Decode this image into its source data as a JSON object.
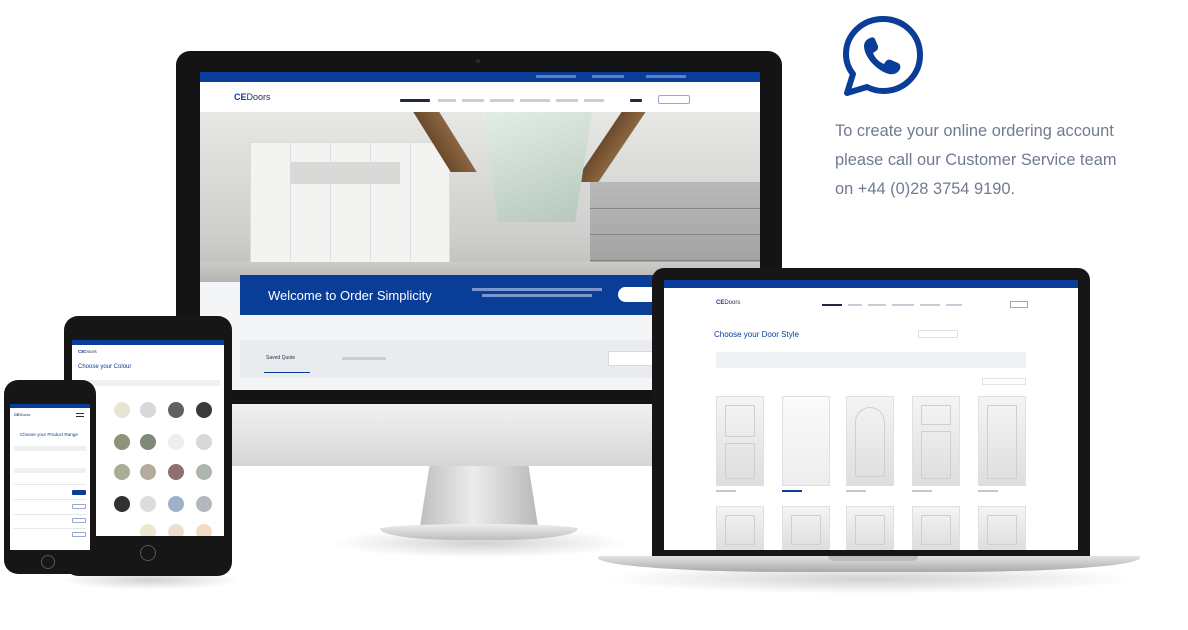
{
  "colors": {
    "brand_blue": "#0a3d97",
    "info_text": "#717b90",
    "device_black": "#161616",
    "whatsapp_blue": "#0a3d97"
  },
  "info": {
    "icon": "whatsapp-icon",
    "lines": [
      "To create your online ordering account",
      "please call our Customer Service team",
      "on +44 (0)28 3754 9190."
    ]
  },
  "desktop": {
    "logo_prefix": "CE",
    "logo_text": "Doors",
    "hero_title": "Welcome to Order Simplicity",
    "tab_active": "Saved Quote"
  },
  "laptop": {
    "logo_prefix": "CE",
    "logo_text": "Doors",
    "page_title": "Choose your Door Style"
  },
  "tablet": {
    "logo_prefix": "CE",
    "logo_text": "Doors",
    "page_title": "Choose your Colour"
  },
  "phone": {
    "logo_prefix": "CE",
    "logo_text": "Doors",
    "page_title": "Choose your Product Range"
  }
}
